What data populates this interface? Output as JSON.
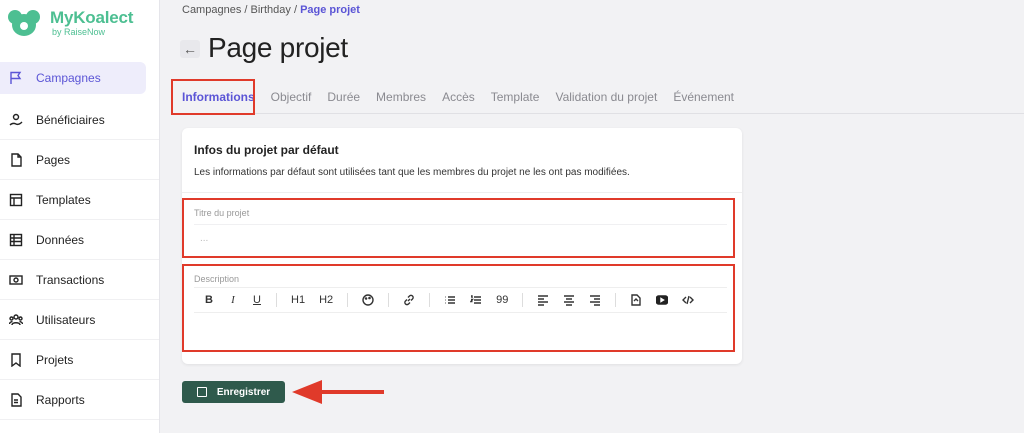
{
  "logo": {
    "title": "MyKoalect",
    "subtitle": "by RaiseNow"
  },
  "sidebar": {
    "items": [
      {
        "label": "Campagnes",
        "icon": "flag-icon",
        "active": true
      },
      {
        "label": "Bénéficiaires",
        "icon": "hand-icon"
      },
      {
        "label": "Pages",
        "icon": "page-icon"
      },
      {
        "label": "Templates",
        "icon": "template-icon"
      },
      {
        "label": "Données",
        "icon": "table-icon"
      },
      {
        "label": "Transactions",
        "icon": "money-icon"
      },
      {
        "label": "Utilisateurs",
        "icon": "users-icon"
      },
      {
        "label": "Projets",
        "icon": "bookmark-icon"
      },
      {
        "label": "Rapports",
        "icon": "report-icon"
      }
    ]
  },
  "breadcrumb": {
    "part1": "Campagnes",
    "sep1": "/",
    "part2": "Birthday",
    "sep2": "/",
    "current": "Page projet"
  },
  "page": {
    "title": "Page projet",
    "back": "←"
  },
  "tabs": [
    {
      "label": "Informations",
      "active": true
    },
    {
      "label": "Objectif"
    },
    {
      "label": "Durée"
    },
    {
      "label": "Membres"
    },
    {
      "label": "Accès"
    },
    {
      "label": "Template"
    },
    {
      "label": "Validation du projet"
    },
    {
      "label": "Événement"
    }
  ],
  "card": {
    "title": "Infos du projet par défaut",
    "description": "Les informations par défaut sont utilisées tant que les membres du projet ne les ont pas modifiées.",
    "title_field": {
      "label": "Titre du projet",
      "placeholder": "..."
    },
    "description_field": {
      "label": "Description"
    },
    "toolbar": {
      "bold": "B",
      "italic": "I",
      "underline": "U",
      "h1": "H1",
      "h2": "H2",
      "quote": "99"
    }
  },
  "save": {
    "label": "Enregistrer"
  },
  "colors": {
    "accent": "#5b55d6",
    "brand": "#4dbf92",
    "highlight": "#e03a2a",
    "button": "#2f5a4c"
  }
}
